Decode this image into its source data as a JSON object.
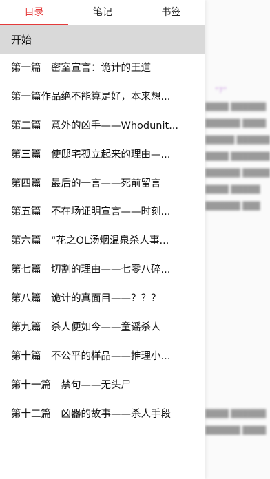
{
  "tabs": [
    {
      "label": "目录",
      "active": true
    },
    {
      "label": "笔记",
      "active": false
    },
    {
      "label": "书签",
      "active": false
    }
  ],
  "toc": {
    "header": "开始",
    "items": [
      "第一篇　密室宣言：诡计的王道",
      "第一篇作品绝不能算是好，本来想...",
      "第二篇　意外的凶手——Whodunit...",
      "第三篇　使邸宅孤立起来的理由—...",
      "第四篇　最后的一言——死前留言",
      "第五篇　不在场证明宣言——时刻...",
      "第六篇　“花之OL汤烟温泉杀人事...",
      "第七篇　切割的理由——七零八碎...",
      "第八篇　诡计的真面目——？？？",
      "第九篇　杀人便如今——童谣杀人",
      "第十篇　不公平的样品——推理小...",
      "第十一篇　禁句——无头尸",
      "第十二篇　凶器的故事——杀人手段"
    ]
  },
  "colors": {
    "accent": "#e43b3b",
    "header_bg": "#d9d9d9"
  }
}
